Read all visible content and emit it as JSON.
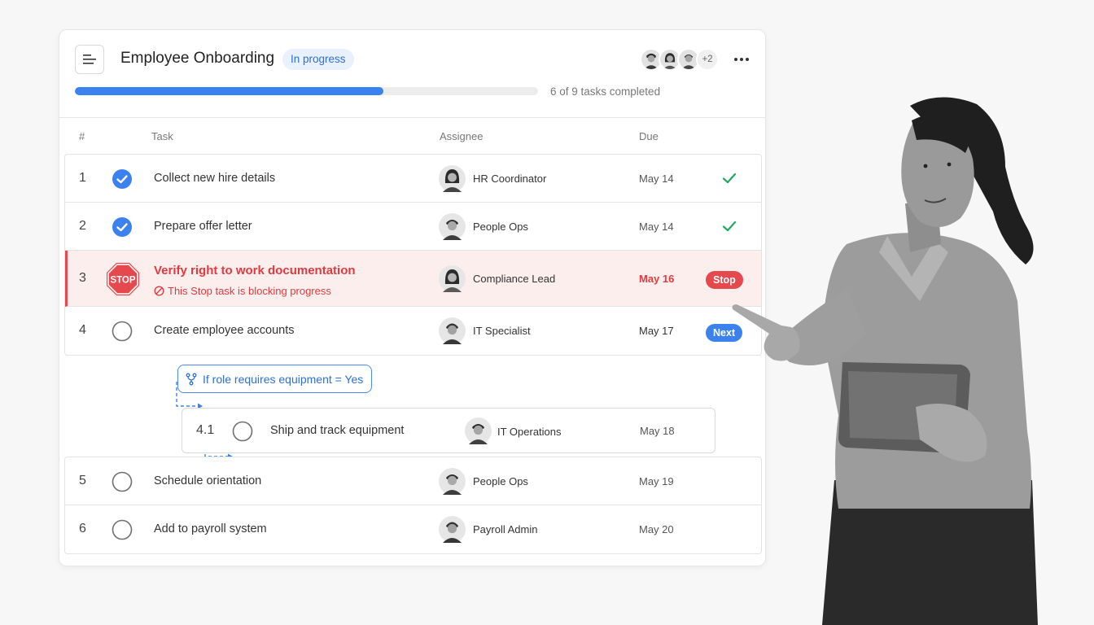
{
  "header": {
    "title": "Employee Onboarding",
    "status": "In progress",
    "more_assignees": "+2",
    "progress_text": "6 of 9 tasks completed",
    "progress_fraction": 0.6667
  },
  "columns": {
    "num": "#",
    "task": "Task",
    "assignee": "Assignee",
    "due": "Due"
  },
  "tasks": [
    {
      "num": "1",
      "title": "Collect new hire details",
      "assignee": "HR Coordinator",
      "due": "May 14",
      "status": "done"
    },
    {
      "num": "2",
      "title": "Prepare offer letter",
      "assignee": "People Ops",
      "due": "May 14",
      "status": "done"
    },
    {
      "num": "3",
      "title": "Verify right to work documentation",
      "subtitle": "This Stop task is blocking progress",
      "assignee": "Compliance Lead",
      "due": "May 16",
      "status": "blocked",
      "badge": "Stop",
      "icon_text": "STOP"
    },
    {
      "num": "4",
      "title": "Create employee accounts",
      "assignee": "IT Specialist",
      "due": "May 17",
      "status": "next",
      "badge": "Next"
    },
    {
      "num": "5",
      "title": "Schedule orientation",
      "assignee": "People Ops",
      "due": "May 19",
      "status": "todo"
    },
    {
      "num": "6",
      "title": "Add to payroll system",
      "assignee": "Payroll Admin",
      "due": "May 20",
      "status": "todo"
    }
  ],
  "condition": {
    "label": "If role requires equipment = Yes"
  },
  "subtask": {
    "num": "4.1",
    "title": "Ship and track equipment",
    "assignee": "IT Operations",
    "due": "May 18",
    "status": "todo"
  },
  "colors": {
    "accent": "#3b82ee",
    "danger": "#e5484d",
    "success": "#22a861",
    "blocked_bg": "#fdeeee"
  }
}
